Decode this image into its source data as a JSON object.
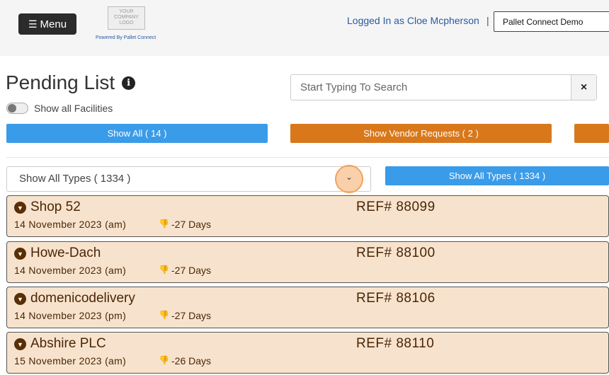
{
  "header": {
    "menu_label": "Menu",
    "menu_icon": "hamburger-icon",
    "logo_lines": [
      "YOUR",
      "COMPANY",
      "LOGO"
    ],
    "powered_by": "Powered By Pallet Connect",
    "logged_in": "Logged In as Cloe Mcpherson",
    "separator": "|",
    "site_selected": "Pallet Connect Demo"
  },
  "page": {
    "title": "Pending List",
    "info_icon": "info-icon",
    "search_placeholder": "Start Typing To Search",
    "search_clear": "×",
    "toggle_label": "Show all Facilities",
    "toggle_on": false
  },
  "filters": {
    "show_all": "Show All ( 14 )",
    "show_vendor": "Show Vendor Requests ( 2 )",
    "type_select_value": "Show All Types ( 1334 )",
    "type_button": "Show All Types ( 1334 )"
  },
  "colors": {
    "blue_button": "#3a9be9",
    "orange_button": "#d9781a",
    "card_bg": "#f7e3cd",
    "card_text": "#4a2606",
    "thumb_down": "#e04646"
  },
  "cards": [
    {
      "name": "Shop 52",
      "date": "14 November 2023 (am)",
      "days": "-27 Days",
      "ref": "REF# 88099"
    },
    {
      "name": "Howe-Dach",
      "date": "14 November 2023 (am)",
      "days": "-27 Days",
      "ref": "REF# 88100"
    },
    {
      "name": "domenicodelivery",
      "date": "14 November 2023 (pm)",
      "days": "-27 Days",
      "ref": "REF# 88106"
    },
    {
      "name": "Abshire PLC",
      "date": "15 November 2023 (am)",
      "days": "-26 Days",
      "ref": "REF# 88110"
    }
  ]
}
